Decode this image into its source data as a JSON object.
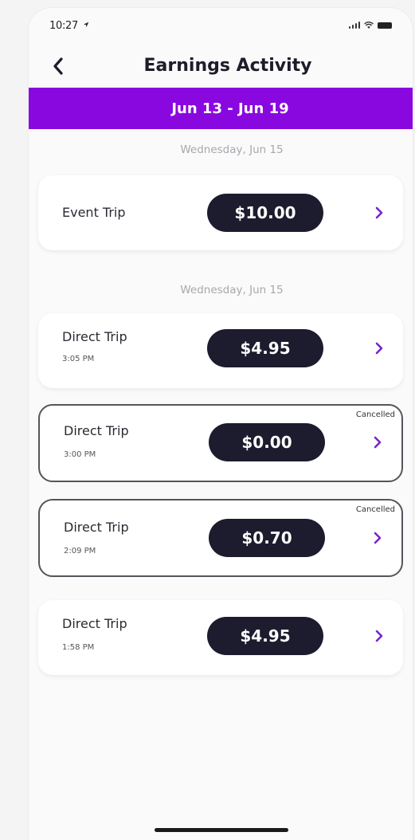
{
  "status_bar": {
    "time": "10:27",
    "location_icon": "location-arrow-icon",
    "signal_icon": "signal-icon",
    "wifi_icon": "wifi-icon",
    "battery_icon": "battery-icon"
  },
  "nav": {
    "back_icon": "chevron-left-icon",
    "title": "Earnings Activity"
  },
  "week": {
    "label": "Jun 13 - Jun 19",
    "color": "#8a08e0"
  },
  "groups": [
    {
      "day": "Wednesday, Jun 15",
      "trips": [
        {
          "type": "Event Trip",
          "time": "",
          "amount": "$10.00",
          "status": ""
        }
      ]
    },
    {
      "day": "Wednesday, Jun 15",
      "trips": [
        {
          "type": "Direct Trip",
          "time": "3:05 PM",
          "amount": "$4.95",
          "status": ""
        },
        {
          "type": "Direct Trip",
          "time": "3:00 PM",
          "amount": "$0.00",
          "status": "Cancelled"
        },
        {
          "type": "Direct Trip",
          "time": "2:09 PM",
          "amount": "$0.70",
          "status": "Cancelled"
        },
        {
          "type": "Direct Trip",
          "time": "1:58 PM",
          "amount": "$4.95",
          "status": ""
        }
      ]
    }
  ],
  "colors": {
    "accent": "#8a08e0",
    "pill": "#1c1c2e",
    "chevron": "#7a24c8",
    "day_header": "#a8a8ae"
  }
}
